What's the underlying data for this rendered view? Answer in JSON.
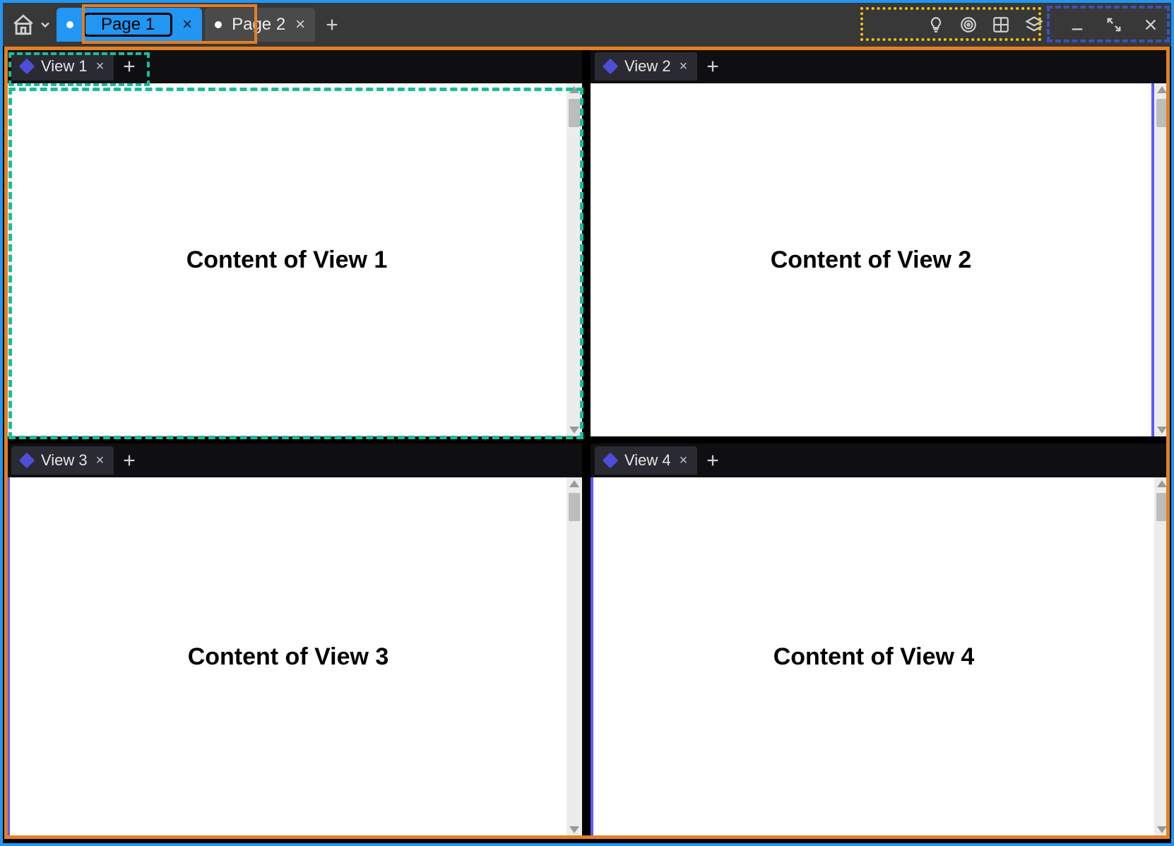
{
  "topbar": {
    "pages": [
      {
        "label": "Page 1",
        "active": true
      },
      {
        "label": "Page 2",
        "active": false
      }
    ]
  },
  "panes": {
    "tl": {
      "tab_label": "View 1",
      "content": "Content of View 1"
    },
    "tr": {
      "tab_label": "View 2",
      "content": "Content of View 2"
    },
    "bl": {
      "tab_label": "View 3",
      "content": "Content of View 3"
    },
    "br": {
      "tab_label": "View 4",
      "content": "Content of View 4"
    }
  }
}
